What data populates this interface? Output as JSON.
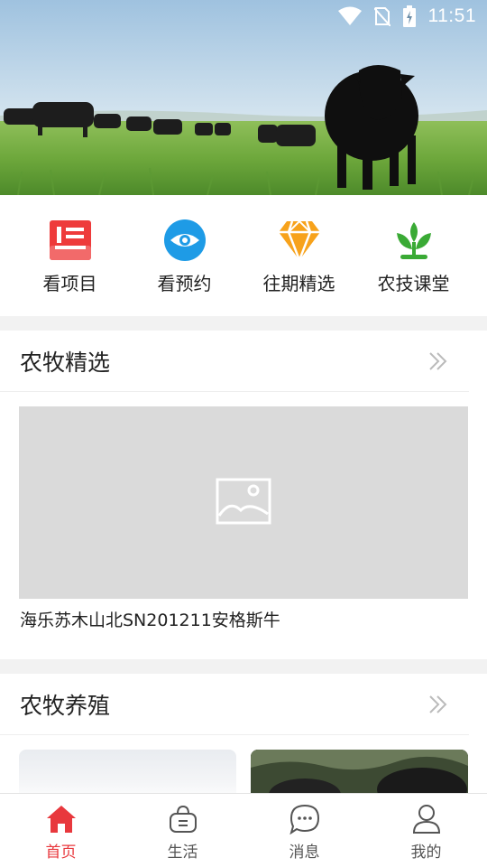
{
  "status_bar": {
    "time": "11:51",
    "icons": [
      "wifi-icon",
      "no-sim-icon",
      "battery-charging-icon"
    ]
  },
  "banner": {
    "image": "black-angus-cattle-on-pasture"
  },
  "quick_nav": [
    {
      "label": "看项目",
      "icon": "project-list-icon",
      "color": "#ee3b3b"
    },
    {
      "label": "看预约",
      "icon": "eye-icon",
      "color": "#1e9be6"
    },
    {
      "label": "往期精选",
      "icon": "diamond-icon",
      "color": "#f7a21b"
    },
    {
      "label": "农技课堂",
      "icon": "sprout-icon",
      "color": "#3aaa35"
    }
  ],
  "sections": {
    "featured": {
      "title": "农牧精选",
      "more_icon": "double-chevron-right-icon",
      "item_caption": "海乐苏木山北SN201211安格斯牛",
      "item_image": "image-placeholder-icon"
    },
    "breeding": {
      "title": "农牧养殖",
      "more_icon": "double-chevron-right-icon"
    }
  },
  "tab_bar": [
    {
      "label": "首页",
      "icon": "home-icon",
      "active": true
    },
    {
      "label": "生活",
      "icon": "shopping-bag-icon",
      "active": false
    },
    {
      "label": "消息",
      "icon": "chat-bubble-icon",
      "active": false
    },
    {
      "label": "我的",
      "icon": "user-icon",
      "active": false
    }
  ],
  "colors": {
    "accent": "#e8383d",
    "background": "#f2f2f2",
    "placeholder": "#dadada"
  }
}
